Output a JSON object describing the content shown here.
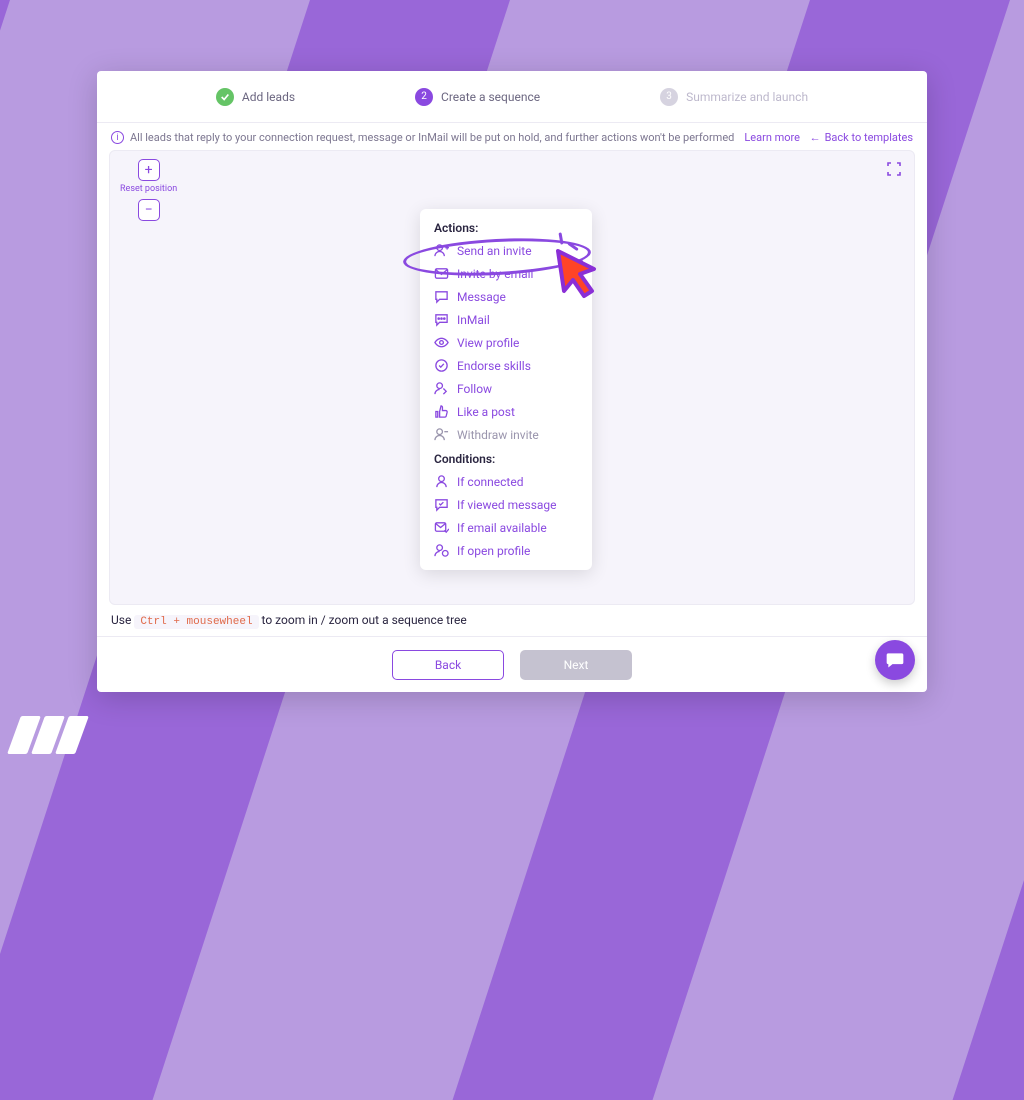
{
  "stepper": {
    "steps": [
      {
        "label": "Add leads",
        "state": "done",
        "num": ""
      },
      {
        "label": "Create a sequence",
        "state": "active",
        "num": "2"
      },
      {
        "label": "Summarize and launch",
        "state": "pending",
        "num": "3"
      }
    ]
  },
  "info": {
    "text": "All leads that reply to your connection request, message or InMail will be put on hold, and further actions won't be performed",
    "learn_more": "Learn more",
    "back_templates": "Back to templates",
    "back_arrow": "←"
  },
  "zoom": {
    "reset_label": "Reset position",
    "plus": "+",
    "minus": "−"
  },
  "menu": {
    "actions_heading": "Actions:",
    "conditions_heading": "Conditions:",
    "actions": [
      {
        "icon": "user-plus",
        "label": "Send an invite"
      },
      {
        "icon": "mail",
        "label": "Invite by email"
      },
      {
        "icon": "chat",
        "label": "Message"
      },
      {
        "icon": "chat-dots",
        "label": "InMail"
      },
      {
        "icon": "eye",
        "label": "View profile"
      },
      {
        "icon": "badge-check",
        "label": "Endorse skills"
      },
      {
        "icon": "user-follow",
        "label": "Follow"
      },
      {
        "icon": "thumbs-up",
        "label": "Like a post"
      },
      {
        "icon": "user-minus",
        "label": "Withdraw invite"
      }
    ],
    "conditions": [
      {
        "icon": "user",
        "label": "If connected"
      },
      {
        "icon": "chat-check",
        "label": "If viewed message"
      },
      {
        "icon": "mail-check",
        "label": "If email available"
      },
      {
        "icon": "user-open",
        "label": "If open profile"
      }
    ]
  },
  "hint": {
    "prefix": "Use ",
    "kbd": "Ctrl + mousewheel",
    "suffix": " to zoom in / zoom out a sequence tree"
  },
  "footer": {
    "back": "Back",
    "next": "Next"
  }
}
